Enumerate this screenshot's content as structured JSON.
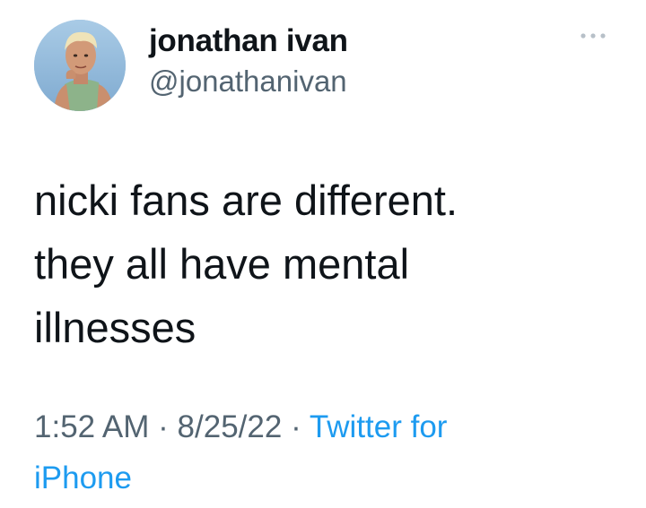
{
  "user": {
    "display_name": "jonathan ivan",
    "handle": "@jonathanivan"
  },
  "tweet": {
    "text_lines": [
      "nicki fans are different.",
      "they all have mental",
      "illnesses"
    ],
    "time": "1:52 AM",
    "date": "8/25/22",
    "separator": "·",
    "source_part1": "Twitter for",
    "source_part2": "iPhone"
  },
  "icons": {
    "more": "more-horizontal-icon",
    "avatar": "profile-photo"
  },
  "colors": {
    "text": "#0f1419",
    "secondary": "#536471",
    "link": "#1d9bf0",
    "background": "#ffffff"
  }
}
